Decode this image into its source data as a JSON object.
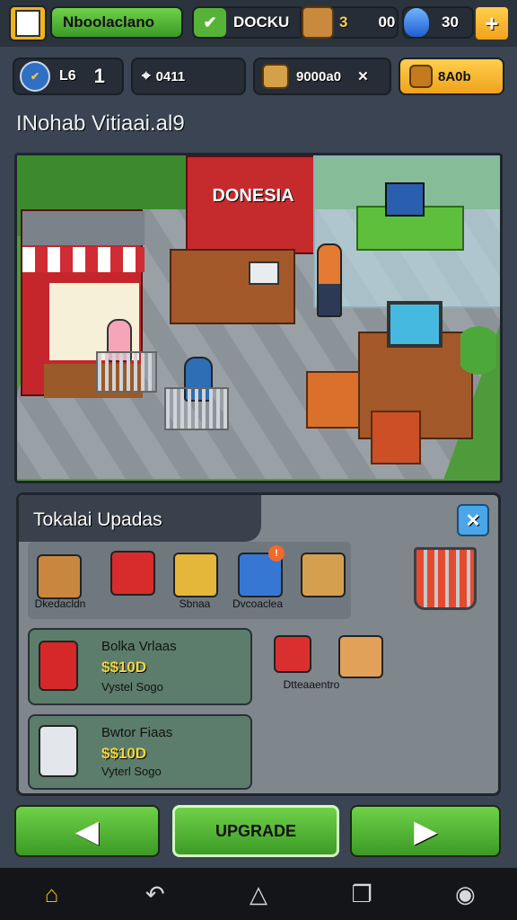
{
  "topbar": {
    "player_name": "Nboolaclano",
    "currency_label": "DOCKU",
    "crate_count": "3",
    "crate_value": "00",
    "gem_count": "30",
    "plus_label": "+"
  },
  "stats": {
    "level_label": "L6",
    "level_value": "1",
    "time_value": "0411",
    "cash_value": "9000a0",
    "shop_label": "8A0b"
  },
  "store_title": "INohab Vitiaai.al9",
  "scene": {
    "sign_text": "DONESIA"
  },
  "panel": {
    "title": "Tokalai Upadas",
    "close_label": "✕",
    "row_items": [
      {
        "icon": "box-icon",
        "label": "Dkedacldn"
      },
      {
        "icon": "red-box-icon",
        "label": ""
      },
      {
        "icon": "gold-crate-icon",
        "label": "Sbnaa"
      },
      {
        "icon": "blue-box-icon",
        "label": "Dvcoaclea"
      },
      {
        "icon": "package-icon",
        "label": ""
      }
    ],
    "upgrades": [
      {
        "name": "Bolka Vrlaas",
        "price": "$$10D",
        "sub": "Vystel Sogo"
      },
      {
        "name": "Bwtor Fiaas",
        "price": "$$10D",
        "sub": "Vyterl Sogo"
      }
    ],
    "right_items_label": "Dtteaaentro"
  },
  "bottom": {
    "left_label": "◀",
    "upgrade_label": "UPGRADE",
    "right_label": "▶"
  },
  "nav": [
    "home-icon",
    "back-icon",
    "house-outline-icon",
    "recent-apps-icon",
    "assistant-icon"
  ]
}
